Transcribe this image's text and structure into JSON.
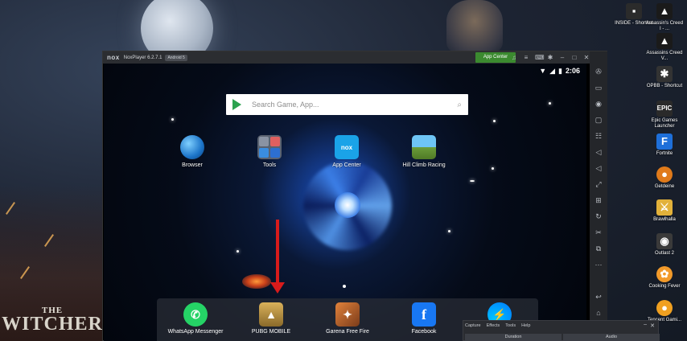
{
  "desktop": {
    "icons": [
      {
        "label": "INSIDE - Shortcut",
        "icon": "inside-icon",
        "color": "#2b2b2b"
      },
      {
        "label": "Assassin's Creed I - ...",
        "icon": "assassins-creed-icon",
        "color": "#1a1a1a"
      },
      {
        "label": "Assassins Creed V...",
        "icon": "assassins-creed-icon",
        "color": "#1a1a1a"
      },
      {
        "label": "OPBB - Shortcut",
        "icon": "opbb-icon",
        "color": "#333333"
      },
      {
        "label": "Epic Games Launcher",
        "icon": "epic-games-icon",
        "color": "#2a2a2a"
      },
      {
        "label": "Fortnite",
        "icon": "fortnite-icon",
        "color": "#1e6fd9"
      },
      {
        "label": "Getdeine",
        "icon": "getdeine-icon",
        "color": "#e07a1a"
      },
      {
        "label": "Brawlhalla",
        "icon": "brawlhalla-icon",
        "color": "#e2b13a"
      },
      {
        "label": "Outlast 2",
        "icon": "outlast-icon",
        "color": "#3a3a3a"
      },
      {
        "label": "Cooking Fever",
        "icon": "cooking-fever-icon",
        "color": "#f29a2a"
      },
      {
        "label": "Tencent Gami...",
        "icon": "tencent-icon",
        "color": "#f0a020"
      }
    ],
    "witcher": {
      "the": "THE",
      "name": "WITCHER"
    }
  },
  "nox": {
    "logo": "nox",
    "title": "NoxPlayer 6.2.7.1",
    "android_badge": "Android 5",
    "app_center": "App Center",
    "status_time": "2:06",
    "search_placeholder": "Search Game, App...",
    "home_apps": [
      {
        "label": "Browser",
        "icon": "browser-icon"
      },
      {
        "label": "Tools",
        "icon": "tools-folder-icon"
      },
      {
        "label": "App Center",
        "icon": "app-center-icon",
        "glyph": "nox"
      },
      {
        "label": "Hill Climb Racing",
        "icon": "hill-climb-icon"
      }
    ],
    "dock_apps": [
      {
        "label": "WhatsApp Messenger",
        "icon": "whatsapp-icon",
        "glyph": "✆"
      },
      {
        "label": "PUBG MOBILE",
        "icon": "pubg-icon",
        "glyph": "▲"
      },
      {
        "label": "Garena Free Fire",
        "icon": "free-fire-icon",
        "glyph": "✦"
      },
      {
        "label": "Facebook",
        "icon": "facebook-icon",
        "glyph": "f"
      },
      {
        "label": "",
        "icon": "messenger-icon",
        "glyph": "⚡"
      }
    ],
    "accent": "#3b8a2f"
  },
  "recorder": {
    "menu": [
      "Capture",
      "Effects",
      "Tools",
      "Help"
    ],
    "tabs": [
      "Duration",
      "Audio"
    ]
  }
}
